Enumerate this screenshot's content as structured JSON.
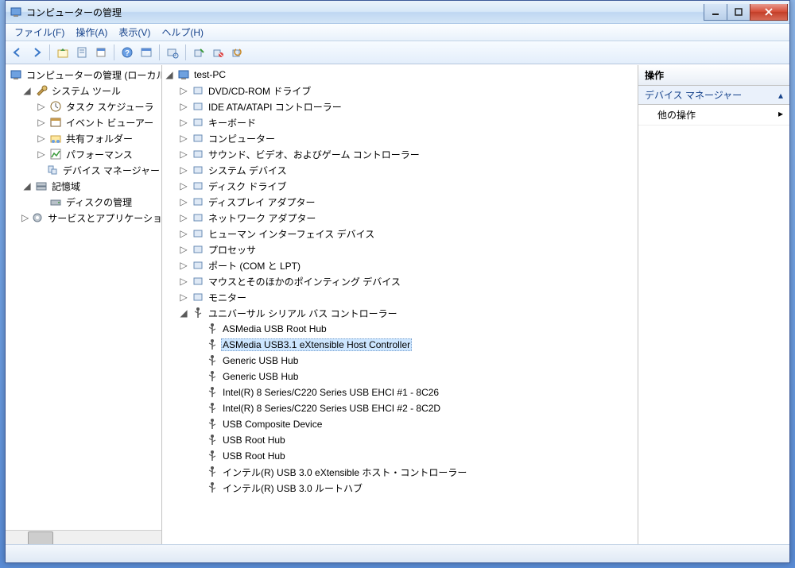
{
  "window": {
    "title": "コンピューターの管理"
  },
  "menu": {
    "file": "ファイル(F)",
    "action": "操作(A)",
    "view": "表示(V)",
    "help": "ヘルプ(H)"
  },
  "toolbar_icons": [
    "back",
    "forward",
    "|",
    "up",
    "props",
    "new",
    "|",
    "help",
    "props2",
    "|",
    "scan",
    "|",
    "enable",
    "disable",
    "update"
  ],
  "left_tree": {
    "root": "コンピューターの管理 (ローカル)",
    "system_tools": "システム ツール",
    "task_scheduler": "タスク スケジューラ",
    "event_viewer": "イベント ビューアー",
    "shared_folders": "共有フォルダー",
    "performance": "パフォーマンス",
    "device_manager": "デバイス マネージャー",
    "storage": "記憶域",
    "disk_mgmt": "ディスクの管理",
    "services_apps": "サービスとアプリケーション"
  },
  "center_tree": {
    "root": "test-PC",
    "categories": [
      "DVD/CD-ROM ドライブ",
      "IDE ATA/ATAPI コントローラー",
      "キーボード",
      "コンピューター",
      "サウンド、ビデオ、およびゲーム コントローラー",
      "システム デバイス",
      "ディスク ドライブ",
      "ディスプレイ アダプター",
      "ネットワーク アダプター",
      "ヒューマン インターフェイス デバイス",
      "プロセッサ",
      "ポート (COM と LPT)",
      "マウスとそのほかのポインティング デバイス",
      "モニター"
    ],
    "usb_label": "ユニバーサル シリアル バス コントローラー",
    "usb_children": [
      "ASMedia USB Root Hub",
      "ASMedia USB3.1 eXtensible Host Controller",
      "Generic USB Hub",
      "Generic USB Hub",
      "Intel(R) 8 Series/C220 Series USB EHCI #1 - 8C26",
      "Intel(R) 8 Series/C220 Series USB EHCI #2 - 8C2D",
      "USB Composite Device",
      "USB Root Hub",
      "USB Root Hub",
      "インテル(R) USB 3.0 eXtensible ホスト・コントローラー",
      "インテル(R) USB 3.0 ルートハブ"
    ],
    "selected_index": 1
  },
  "right": {
    "header": "操作",
    "band": "デバイス マネージャー",
    "other": "他の操作"
  }
}
